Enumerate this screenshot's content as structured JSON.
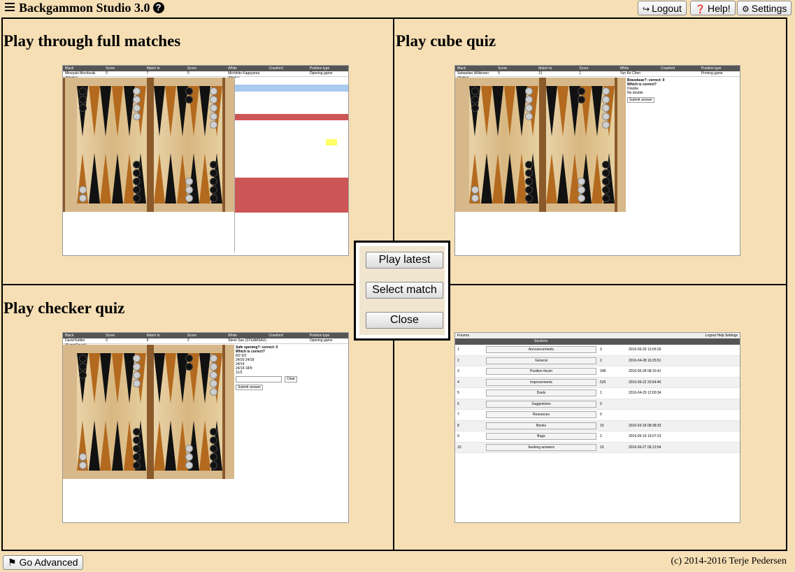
{
  "header": {
    "title": "Backgammon Studio 3.0",
    "help_icon": "?",
    "buttons": {
      "logout": "Logout",
      "help": "Help!",
      "settings": "Settings"
    }
  },
  "quadrants": {
    "top_left": {
      "title": "Play through full matches"
    },
    "top_right": {
      "title": "Play cube quiz"
    },
    "bottom_left": {
      "title": "Play checker quiz"
    }
  },
  "dialog": {
    "play_latest": "Play latest",
    "select_match": "Select match",
    "close": "Close"
  },
  "footer": {
    "go_advanced": "Go Advanced",
    "copyright": "(c) 2014-2016 Terje Pedersen"
  },
  "thumb_headers": [
    "Black",
    "Score",
    "Match to",
    "Score",
    "White",
    "Crawford",
    "Position type"
  ],
  "thumbs": {
    "matches": {
      "players": [
        "Mineyuki Mochizuki (Mochy)",
        "0",
        "7",
        "0",
        "Michihito Kageyama (Michy)",
        "",
        "Opening game"
      ]
    },
    "cube": {
      "players": [
        "Sebastian Wilkinson (Pyrho)",
        "5",
        "11",
        "1",
        "Yun Ke Chen",
        "",
        "Priming game"
      ],
      "question": "Bravebear?: correct: 0",
      "prompt": "Which is correct?",
      "options": [
        "Double",
        "No double"
      ],
      "submit": "Submit answer"
    },
    "checker": {
      "players": [
        "David Kettler (SuperDavek)",
        "0",
        "9",
        "2",
        "Steve Sax (STEAMSAX)",
        "",
        "Opening game"
      ],
      "question": "Safe opening?: correct: 0",
      "prompt": "Which is correct?",
      "options": [
        "8/2 6/2",
        "24/20 24/18",
        "24/14",
        "24/18 18/9",
        "11/3"
      ],
      "clear": "Clear",
      "submit": "Submit answer"
    }
  },
  "forums": {
    "title": "Forums",
    "mini_buttons": [
      "Logout",
      "Help",
      "Settings"
    ],
    "columns": [
      "Sections"
    ],
    "rows": [
      {
        "n": "1",
        "section": "Announcements",
        "count": "3",
        "date": "2016-06-29 13:05:29"
      },
      {
        "n": "2",
        "section": "General",
        "count": "2",
        "date": "2016-04-28 16:25:51"
      },
      {
        "n": "3",
        "section": "Position forum",
        "count": "248",
        "date": "2016-06-28 08:15:41"
      },
      {
        "n": "4",
        "section": "Improvements",
        "count": "529",
        "date": "2016-06-22 20:54:40"
      },
      {
        "n": "5",
        "section": "Duels",
        "count": "1",
        "date": "2016-04-29 12:00:34"
      },
      {
        "n": "6",
        "section": "Suggestions",
        "count": "0",
        "date": ""
      },
      {
        "n": "7",
        "section": "Resources",
        "count": "0",
        "date": ""
      },
      {
        "n": "8",
        "section": "Books",
        "count": "10",
        "date": "2016-03-18 08:38:33"
      },
      {
        "n": "9",
        "section": "Bugs",
        "count": "2",
        "date": "2016-05-19 19:07:23"
      },
      {
        "n": "10",
        "section": "Seeking answers",
        "count": "10",
        "date": "2016-06-27 06:13:54"
      }
    ]
  },
  "colors": {
    "background": "#f6dfb5",
    "thumb_header": "#555555",
    "red_row": "#cc5555",
    "board_bar": "#8b5a2b"
  }
}
